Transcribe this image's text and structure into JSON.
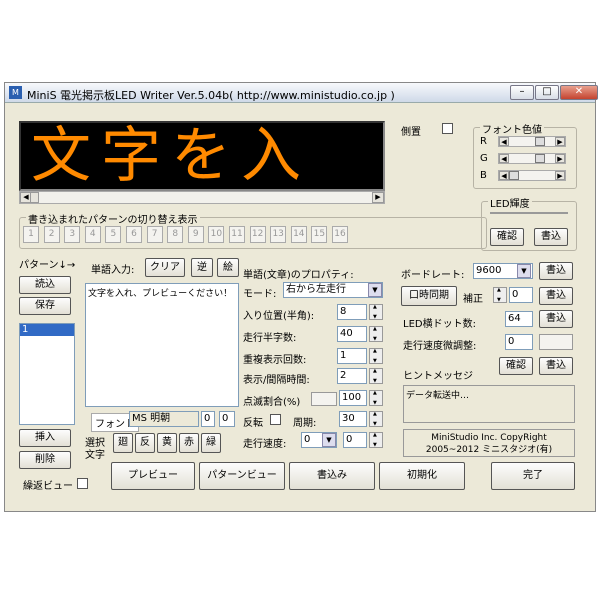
{
  "window": {
    "title": "MiniS 電光掲示板LED Writer   Ver.5.04b( http://www.ministudio.co.jp )",
    "icon": "M"
  },
  "led": {
    "text": "文字を入"
  },
  "mirror_label": "側置",
  "font_color": {
    "legend": "フォント色値",
    "r": "R",
    "g": "G",
    "b": "B"
  },
  "led_brightness": {
    "legend": "LED輝度",
    "confirm": "確認",
    "write": "書込"
  },
  "switch_group": {
    "legend": "書き込まれたパターンの切り替え表示",
    "tabs": [
      "1",
      "2",
      "3",
      "4",
      "5",
      "6",
      "7",
      "8",
      "9",
      "10",
      "11",
      "12",
      "13",
      "14",
      "15",
      "16"
    ]
  },
  "pattern": {
    "label": "パターン↓→",
    "read": "読込",
    "save": "保存",
    "items": [
      "1"
    ],
    "insert": "挿入",
    "delete": "削除",
    "repeat_preview": "繰返ビュー"
  },
  "word_input": {
    "label": "単語入力:",
    "clear": "クリア",
    "reverse": "逆",
    "picture": "絵",
    "text": "文字を入れ、プレビューください！"
  },
  "font": {
    "tab_label": "フォント",
    "name": "MS 明朝",
    "v1": "0",
    "v2": "0"
  },
  "select_char": {
    "label1": "選択",
    "label2": "文字",
    "buttons": [
      "廻",
      "反",
      "黄",
      "赤",
      "緑"
    ]
  },
  "properties": {
    "title": "単語(文章)のプロパティ:",
    "mode_label": "モード:",
    "mode_value": "右から左走行",
    "entry_label": "入り位置(半角):",
    "entry_value": "8",
    "halfwidth_label": "走行半字数:",
    "halfwidth_value": "40",
    "repeat_label": "重複表示回数:",
    "repeat_value": "1",
    "interval_label": "表示/間隔時間:",
    "interval_value": "2",
    "blink_label": "点滅割合(%)",
    "blink_value": "100",
    "invert_label": "反転",
    "cycle_label": "周期:",
    "cycle_value": "30",
    "speed_label": "走行速度:",
    "speed_value": "0",
    "speed_value2": "0"
  },
  "board": {
    "baud_label": "ボードレート:",
    "baud_value": "9600",
    "baud_write": "書込",
    "sync_button": "口時同期",
    "correction_label": "補正",
    "correction_value": "0",
    "sync_write": "書込",
    "dots_label": "LED横ドット数:",
    "dots_value": "64",
    "dots_write": "書込",
    "speed_adjust_label": "走行速度微調整:",
    "speed_adjust_value": "0",
    "confirm": "確認",
    "write": "書込"
  },
  "hint": {
    "label": "ヒントメッセジ",
    "text": "データ転送中…"
  },
  "copyright": {
    "line1": "MiniStudio Inc. CopyRight",
    "line2": "2005~2012   ミニスタジオ(有)"
  },
  "bottom_buttons": {
    "preview": "プレビュー",
    "pattern_view": "パターンビュー",
    "write": "書込み",
    "initialize": "初期化",
    "finish": "完了"
  }
}
